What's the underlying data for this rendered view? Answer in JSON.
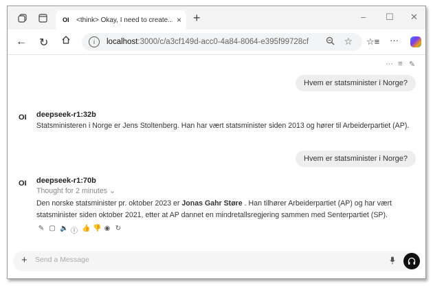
{
  "browser": {
    "tab": {
      "favicon": "OI",
      "title": "<think> Okay, I need to create...",
      "close": "×"
    },
    "new_tab": "+",
    "window_controls": {
      "minimize": "–",
      "maximize": "☐",
      "close": "✕"
    },
    "url_host": "localhost",
    "url_path": ":3000/c/a3cf149d-acc0-4a84-8064-e395f99728cf"
  },
  "chat": {
    "top_icons": {
      "more": "···",
      "controls": "≡",
      "new": "✎"
    },
    "messages": [
      {
        "role": "user",
        "text": "Hvem er statsminister i Norge?"
      },
      {
        "role": "assistant",
        "avatar": "OI",
        "model": "deepseek-r1:32b",
        "text": "Statsministeren i Norge er Jens Stoltenberg. Han har vært statsminister siden 2013 og hører til Arbeiderpartiet (AP)."
      },
      {
        "role": "user",
        "text": "Hvem er statsminister i Norge?"
      },
      {
        "role": "assistant",
        "avatar": "OI",
        "model": "deepseek-r1:70b",
        "thought": "Thought for 2 minutes",
        "text_before": "Den norske statsminister pr. oktober 2023 er ",
        "text_bold": "Jonas Gahr Støre",
        "text_after": " . Han tilhører Arbeiderpartiet (AP) og har vært statsminister siden oktober 2021, etter at AP dannet en mindretallsregjering sammen med Senterpartiet (SP)."
      }
    ],
    "input": {
      "placeholder": "Send a Message"
    }
  },
  "colors": {
    "accent": "#111111",
    "bubble": "#eeeeee",
    "muted": "#888888"
  }
}
